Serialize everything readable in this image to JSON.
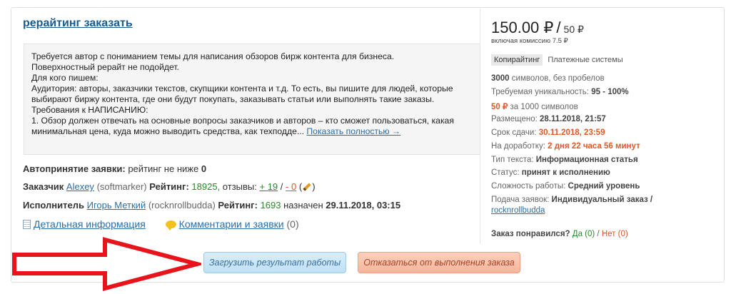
{
  "order": {
    "title": "рерайтинг заказать",
    "description_lines": [
      "Требуется автор с пониманием темы для написания обзоров бирж контента для бизнеса.",
      "Поверхностный рерайт не подойдет.",
      "Для кого пишем:",
      "Аудитория: авторы, заказчики текстов, скупщики контента и т.д. То есть, вы пишите для людей, которые выбирают биржу контента, где они будут покупать, заказывать статьи или выполнять такие заказы.",
      "Требования к НАПИСАНИЮ:",
      "1. Обзор должен отвечать на основные вопросы заказчиков и авторов – кто сможет пользоваться, какая минимальная цена, куда можно выводить средства, как техподде..."
    ],
    "show_full_link": "Показать полностью →",
    "auto_accept_label": "Автопринятие заявки:",
    "auto_accept_text": "рейтинг не ниже",
    "auto_accept_value": "0",
    "customer": {
      "label": "Заказчик",
      "name": "Alexey",
      "login": "(softmarker)",
      "rating_label": "Рейтинг:",
      "rating": "18925,",
      "reviews_label": "отзывы:",
      "reviews_pos": "+ 19",
      "separator": "/",
      "reviews_neg": "- 0",
      "reviews_open": "(",
      "reviews_close": ")"
    },
    "executor": {
      "label": "Исполнитель",
      "name": "Игорь Меткий",
      "login": "(rocknrollbudda)",
      "rating_label": "Рейтинг:",
      "rating": "1693",
      "assigned_label": "назначен",
      "assigned_at": "29.11.2018, 03:15"
    },
    "details_link": "Детальная информация",
    "comments_link": "Комментарии и заявки",
    "comments_count": "(0)"
  },
  "buttons": {
    "upload": "Загрузить результат работы",
    "refuse": "Отказаться от выполнения заказа"
  },
  "info": {
    "price": "150.00 ₽",
    "slash": "/",
    "price_per": "50 ₽",
    "commission": "включая комиссию 7.5 ₽",
    "category_main": "Копирайтинг",
    "category_sub": "Платежные системы",
    "chars_value": "3000",
    "chars_text": "символов, без пробелов",
    "uniqueness_label": "Требуемая уникальность:",
    "uniqueness_value": "95 - 100%",
    "rate_value": "50 ₽",
    "rate_text": "за 1000 символов",
    "posted_label": "Размещено:",
    "posted_value": "28.11.2018, 21:57",
    "deadline_label": "Срок сдачи:",
    "deadline_value": "30.11.2018, 23:59",
    "revision_label": "На доработку:",
    "revision_value": "2 дня 22 часа 56 минут",
    "text_type_label": "Тип текста:",
    "text_type_value": "Информационная статья",
    "status_label": "Статус:",
    "status_value": "принят к исполнению",
    "difficulty_label": "Сложность работы:",
    "difficulty_value": "Средний уровень",
    "application_label": "Подача заявок:",
    "application_value": "Индивидуальный заказ /",
    "application_user": "rocknrollbudda",
    "liked_label": "Заказ понравился?",
    "liked_yes": "Да (0)",
    "liked_sep": "/",
    "liked_no": "Нет (0)"
  },
  "colors": {
    "link": "#2a6ea8",
    "accent_red": "#e2572a",
    "arrow_red": "#e8141c",
    "green": "#2a8a2a"
  },
  "icons": [
    "document-icon",
    "comment-bubble-icon",
    "pencil-icon",
    "red-arrow-icon"
  ]
}
